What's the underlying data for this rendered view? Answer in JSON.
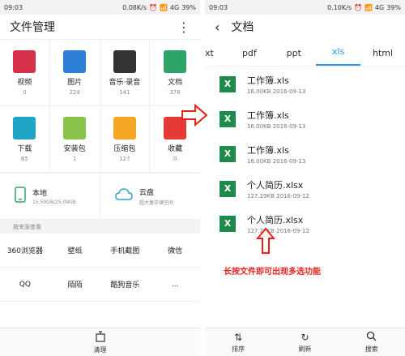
{
  "left": {
    "status": {
      "time": "09:03",
      "speed": "0.08K/s",
      "battery": "39%",
      "net": "4G"
    },
    "title": "文件管理",
    "categories": [
      {
        "label": "视频",
        "count": "0",
        "color": "#d6314a"
      },
      {
        "label": "图片",
        "count": "224",
        "color": "#2e7fd6"
      },
      {
        "label": "音乐·录音",
        "count": "141",
        "color": "#333333"
      },
      {
        "label": "文档",
        "count": "376",
        "color": "#2ea36a"
      },
      {
        "label": "下载",
        "count": "65",
        "color": "#1fa3c7"
      },
      {
        "label": "安装包",
        "count": "1",
        "color": "#8bc34a"
      },
      {
        "label": "压缩包",
        "count": "127",
        "color": "#f5a623"
      },
      {
        "label": "收藏",
        "count": "0",
        "color": "#e53935"
      }
    ],
    "storage": [
      {
        "title": "本地",
        "sub": "15.50GB/25.09GB"
      },
      {
        "title": "云盘",
        "sub": "超大量存储空间"
      }
    ],
    "source_title": "按来源查看",
    "sources": [
      "360浏览器",
      "壁纸",
      "手机截图",
      "微信",
      "QQ",
      "陌陌",
      "酷狗音乐",
      "..."
    ],
    "bottom": {
      "clean": "清理"
    }
  },
  "right": {
    "status": {
      "time": "09:03",
      "speed": "0.10K/s",
      "battery": "39%",
      "net": "4G"
    },
    "title": "文档",
    "tabs": [
      "xt",
      "pdf",
      "ppt",
      "xls",
      "html"
    ],
    "files": [
      {
        "name": "工作簿.xls",
        "meta": "16.00KB  2016-09-13"
      },
      {
        "name": "工作簿.xls",
        "meta": "16.00KB  2016-09-13"
      },
      {
        "name": "工作簿.xls",
        "meta": "16.00KB  2016-09-13"
      },
      {
        "name": "个人简历.xlsx",
        "meta": "127.29KB  2016-09-12"
      },
      {
        "name": "个人简历.xlsx",
        "meta": "127.29KB  2016-09-12"
      }
    ],
    "note": "长按文件即可出现多选功能",
    "bottom": {
      "sort": "排序",
      "refresh": "刷新",
      "search": "搜索"
    }
  }
}
